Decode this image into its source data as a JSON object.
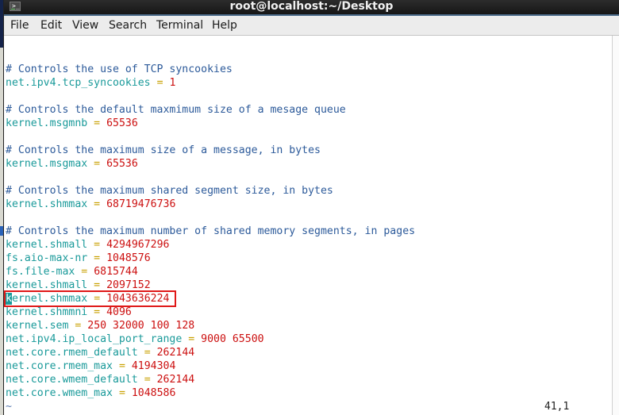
{
  "window": {
    "title": "root@localhost:~/Desktop",
    "icon": "terminal-icon"
  },
  "menu": [
    "File",
    "Edit",
    "View",
    "Search",
    "Terminal",
    "Help"
  ],
  "editor": {
    "lines": [
      {
        "type": "blank"
      },
      {
        "type": "comment",
        "text": "# Controls the use of TCP syncookies"
      },
      {
        "type": "setting",
        "key": "net.ipv4.tcp_syncookies",
        "value": "1"
      },
      {
        "type": "blank"
      },
      {
        "type": "comment",
        "text": "# Controls the default maxmimum size of a mesage queue"
      },
      {
        "type": "setting",
        "key": "kernel.msgmnb",
        "value": "65536"
      },
      {
        "type": "blank"
      },
      {
        "type": "comment",
        "text": "# Controls the maximum size of a message, in bytes"
      },
      {
        "type": "setting",
        "key": "kernel.msgmax",
        "value": "65536"
      },
      {
        "type": "blank"
      },
      {
        "type": "comment",
        "text": "# Controls the maximum shared segment size, in bytes"
      },
      {
        "type": "setting",
        "key": "kernel.shmmax",
        "value": "68719476736"
      },
      {
        "type": "blank"
      },
      {
        "type": "comment",
        "text": "# Controls the maximum number of shared memory segments, in pages"
      },
      {
        "type": "setting",
        "key": "kernel.shmall",
        "value": "4294967296"
      },
      {
        "type": "setting",
        "key": "fs.aio-max-nr",
        "value": "1048576"
      },
      {
        "type": "setting",
        "key": "fs.file-max",
        "value": "6815744"
      },
      {
        "type": "setting",
        "key": "kernel.shmall",
        "value": "2097152"
      },
      {
        "type": "setting",
        "key": "kernel.shmmax",
        "value": "1043636224",
        "cursor": true,
        "highlighted": true
      },
      {
        "type": "setting",
        "key": "kernel.shmmni",
        "value": "4096"
      },
      {
        "type": "setting",
        "key": "kernel.sem",
        "value": "250 32000 100 128"
      },
      {
        "type": "setting",
        "key": "net.ipv4.ip_local_port_range",
        "value": "9000 65500"
      },
      {
        "type": "setting",
        "key": "net.core.rmem_default",
        "value": "262144"
      },
      {
        "type": "setting",
        "key": "net.core.rmem_max",
        "value": "4194304"
      },
      {
        "type": "setting",
        "key": "net.core.wmem_default",
        "value": "262144"
      },
      {
        "type": "setting",
        "key": "net.core.wmem_max",
        "value": "1048586"
      },
      {
        "type": "tilde",
        "text": "~"
      }
    ],
    "equals": "=",
    "cursor_position": "41,1"
  },
  "colors": {
    "comment": "#2c5a9a",
    "key": "#1a9a9a",
    "equals": "#c8a000",
    "value": "#cc1010",
    "highlight_box": "#e01818"
  }
}
